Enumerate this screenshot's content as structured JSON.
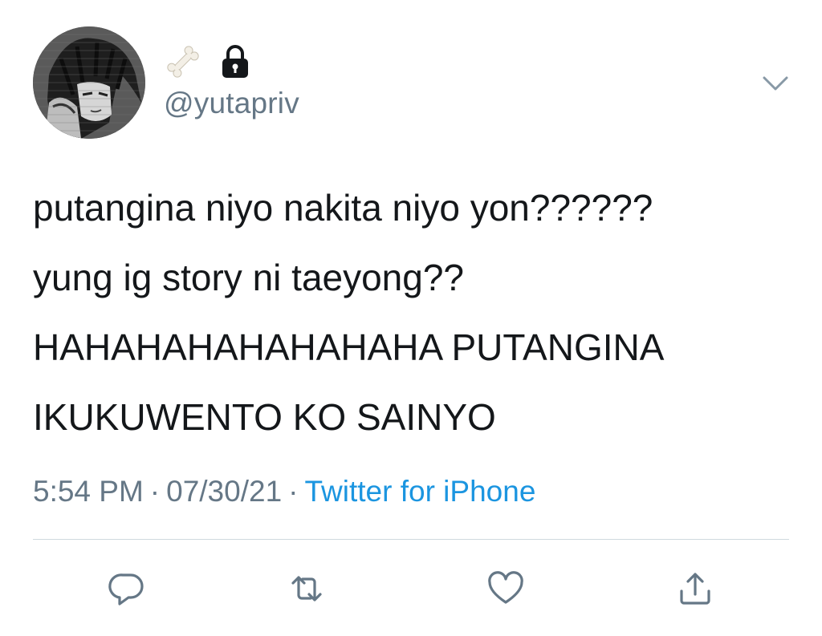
{
  "user": {
    "handle": "@yutapriv",
    "display_name_icons": [
      "bone-emoji",
      "lock-icon"
    ],
    "avatar": "anime-avatar"
  },
  "tweet": {
    "lines": [
      "putangina niyo nakita niyo yon??????",
      "yung ig story ni taeyong??",
      "HAHAHAHAHAHAHAHA PUTANGINA",
      "IKUKUWENTO KO SAINYO"
    ]
  },
  "meta": {
    "time": "5:54 PM",
    "separator": "·",
    "date": "07/30/21",
    "source": "Twitter for iPhone"
  },
  "actions": [
    "reply-icon",
    "retweet-icon",
    "like-icon",
    "share-icon"
  ],
  "colors": {
    "text": "#14171a",
    "secondary": "#657786",
    "link": "#1b95e0",
    "divider": "#cfd9de"
  }
}
